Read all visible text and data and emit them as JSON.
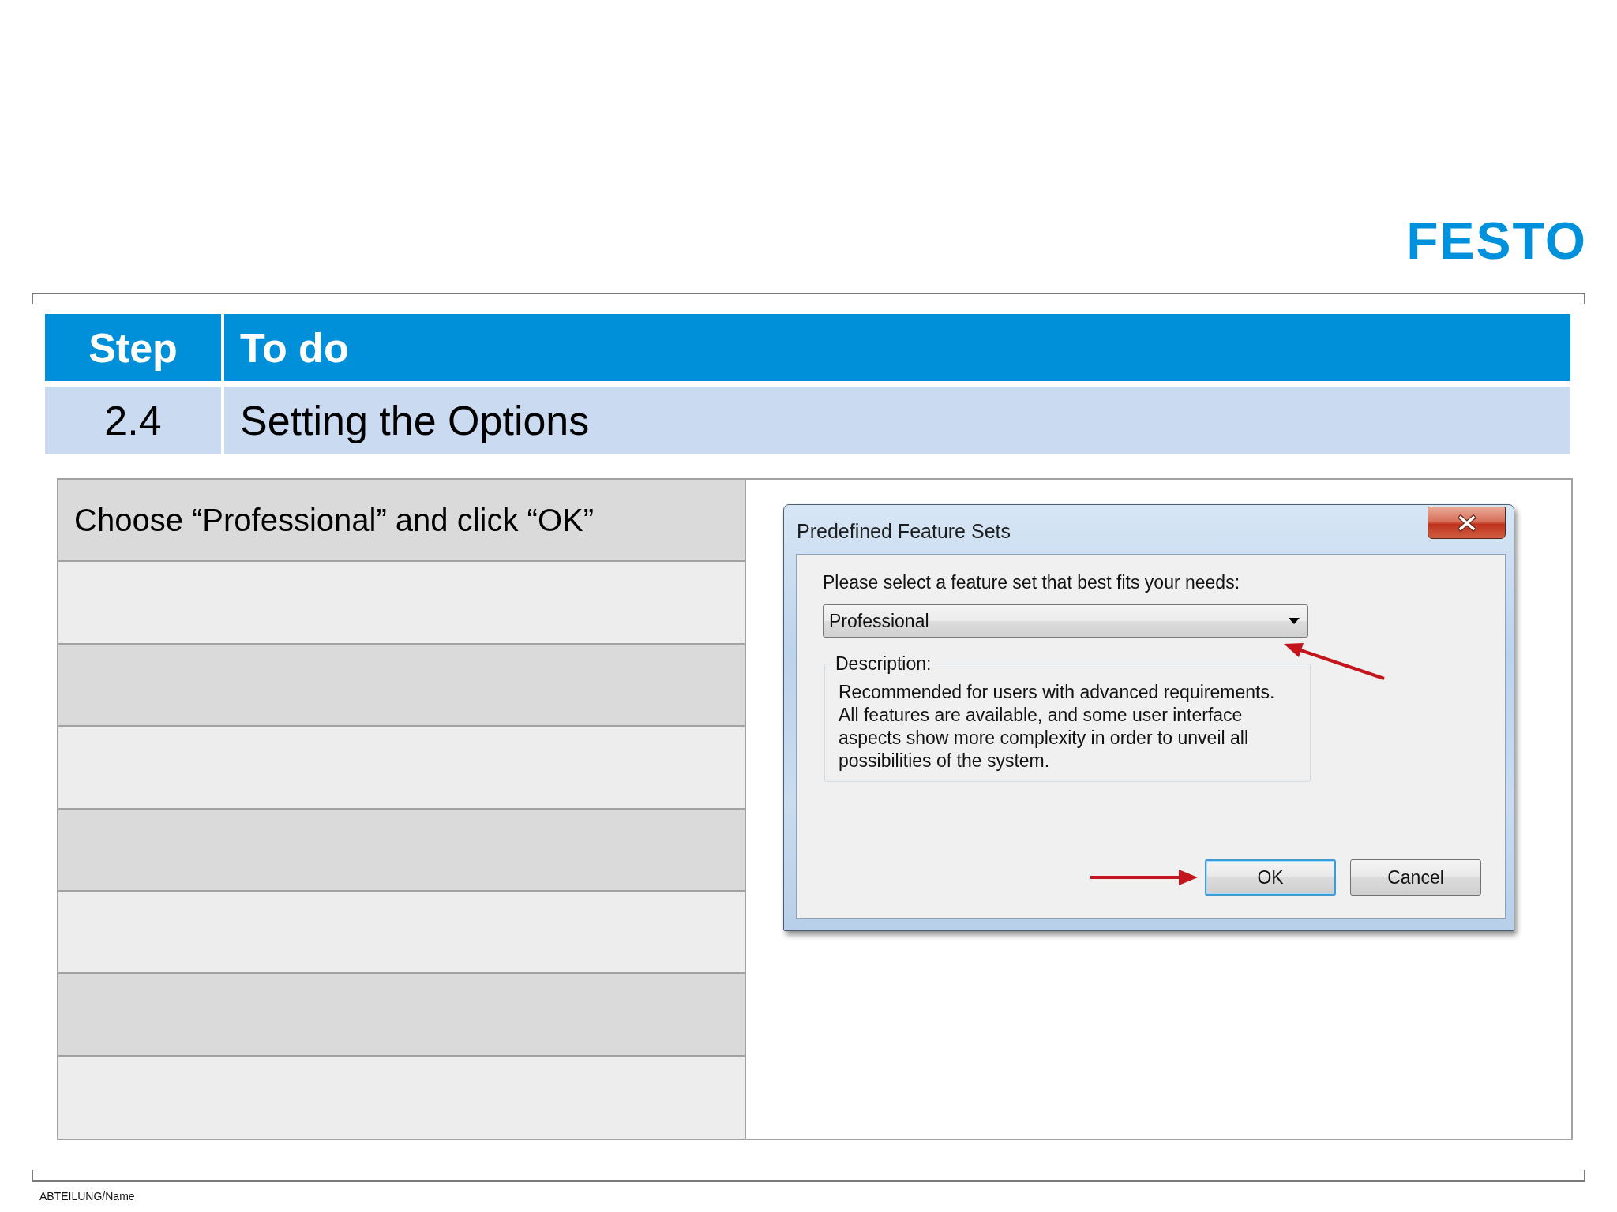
{
  "logo": {
    "text": "FESTO"
  },
  "step_table": {
    "columns": [
      "Step",
      "To do"
    ],
    "rows": [
      [
        "2.4",
        "Setting the Options"
      ]
    ]
  },
  "instructions": [
    {
      "text": "Choose “Professional” and click “OK”"
    }
  ],
  "dialog": {
    "title": "Predefined Feature Sets",
    "prompt": "Please select a feature set that best fits your needs:",
    "dropdown": {
      "value": "Professional"
    },
    "group_label": "Description:",
    "description": "Recommended for users with advanced requirements. All features are available, and some user interface aspects show more complexity in order to unveil all possibilities of the system.",
    "buttons": [
      {
        "label": "OK",
        "default": true
      },
      {
        "label": "Cancel",
        "default": false
      }
    ]
  },
  "footer": {
    "text": "ABTEILUNG/Name"
  }
}
